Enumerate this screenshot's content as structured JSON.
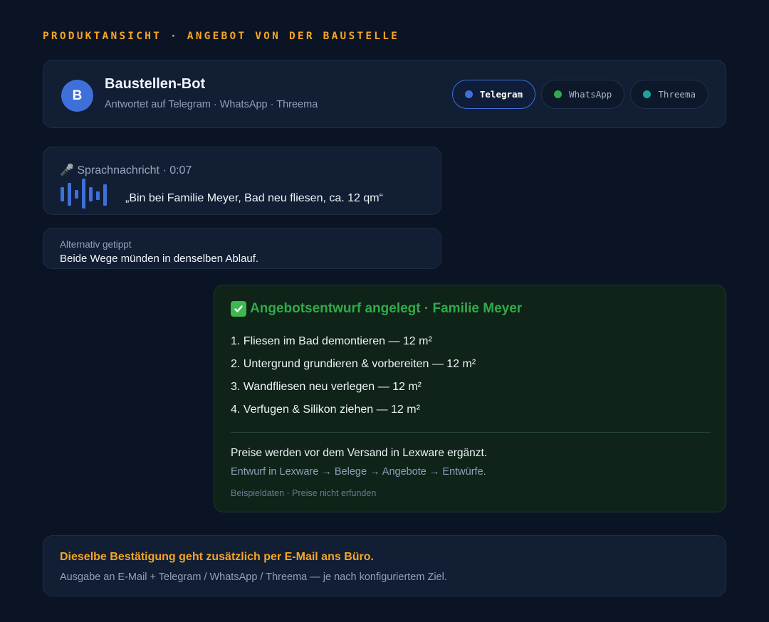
{
  "eyebrow": "PRODUKTANSICHT · ANGEBOT VON DER BAUSTELLE",
  "bot": {
    "avatar_letter": "B",
    "name": "Baustellen-Bot",
    "subtitle": "Antwortet auf Telegram · WhatsApp · Threema"
  },
  "channels": [
    {
      "label": "Telegram",
      "color": "#3f6fd8",
      "active": true
    },
    {
      "label": "WhatsApp",
      "color": "#2faa4a",
      "active": false
    },
    {
      "label": "Threema",
      "color": "#1aa79a",
      "active": false
    }
  ],
  "voice_message": {
    "icon": "microphone-icon",
    "title": "🎤 Sprachnachricht · 0:07",
    "transcript": "„Bin bei Familie Meyer, Bad neu fliesen, ca. 12 qm“"
  },
  "typed_alternative": {
    "label": "Alternativ getippt",
    "text": "Beide Wege münden in denselben Ablauf."
  },
  "offer": {
    "icon": "check-icon",
    "title": "Angebotsentwurf angelegt · Familie Meyer",
    "items": [
      "1. Fliesen im Bad demontieren — 12 m²",
      "2. Untergrund grundieren & vorbereiten — 12 m²",
      "3. Wandfliesen neu verlegen — 12 m²",
      "4. Verfugen & Silikon ziehen — 12 m²"
    ],
    "price_note": "Preise werden vor dem Versand in Lexware ergänzt.",
    "path_note": "Entwurf in Lexware → Belege → Angebote → Entwürfe.",
    "sample_note": "Beispieldaten · Preise nicht erfunden"
  },
  "footer": {
    "title": "Dieselbe Bestätigung geht zusätzlich per E-Mail ans Büro.",
    "subtitle": "Ausgabe an E-Mail + Telegram / WhatsApp / Threema — je nach konfiguriertem Ziel."
  }
}
